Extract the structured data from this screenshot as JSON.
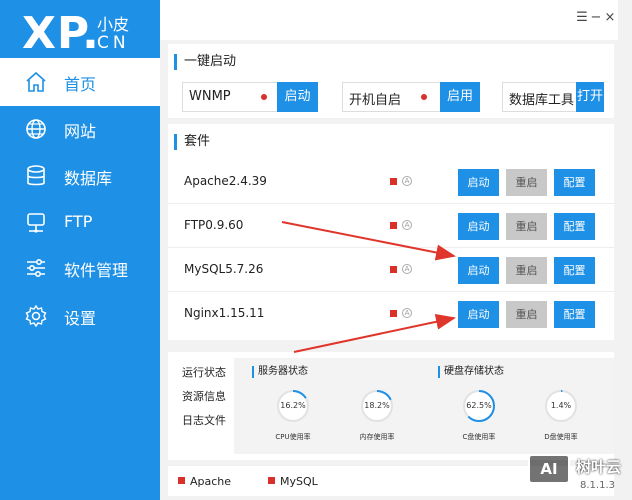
{
  "app": {
    "logo_main": "XP.",
    "logo_sub": "小皮",
    "logo_cn": "CN",
    "version": "8.1.1.3",
    "colors": {
      "accent": "#1e90e6",
      "status_red": "#d9302c",
      "arrow_red": "#e0352b"
    }
  },
  "sidebar": {
    "items": [
      {
        "label": "首页",
        "icon": "home-icon",
        "active": true
      },
      {
        "label": "网站",
        "icon": "globe-icon",
        "active": false
      },
      {
        "label": "数据库",
        "icon": "database-icon",
        "active": false
      },
      {
        "label": "FTP",
        "icon": "server-icon",
        "active": false
      },
      {
        "label": "软件管理",
        "icon": "sliders-icon",
        "active": false
      },
      {
        "label": "设置",
        "icon": "gear-icon",
        "active": false
      }
    ]
  },
  "window": {
    "menu_icon": "☰",
    "minimize_icon": "−",
    "close_icon": "×"
  },
  "quickstart": {
    "title": "一键启动",
    "items": [
      {
        "label": "WNMP",
        "button": "启动"
      },
      {
        "label": "开机自启",
        "button": "启用"
      },
      {
        "label": "数据库工具",
        "button": "打开"
      }
    ]
  },
  "suite": {
    "title": "套件",
    "rows": [
      {
        "name": "Apache2.4.39",
        "start": "启动",
        "restart": "重启",
        "config": "配置",
        "circle": "A"
      },
      {
        "name": "FTP0.9.60",
        "start": "启动",
        "restart": "重启",
        "config": "配置",
        "circle": "A"
      },
      {
        "name": "MySQL5.7.26",
        "start": "启动",
        "restart": "重启",
        "config": "配置",
        "circle": "A"
      },
      {
        "name": "Nginx1.15.11",
        "start": "启动",
        "restart": "重启",
        "config": "配置",
        "circle": "A"
      }
    ]
  },
  "bottom_tabs": [
    "运行状态",
    "资源信息",
    "日志文件"
  ],
  "server_status": {
    "title": "服务器状态",
    "gauges": [
      {
        "value": "16.2%",
        "percent": 16.2,
        "label": "CPU使用率"
      },
      {
        "value": "18.2%",
        "percent": 18.2,
        "label": "内存使用率"
      }
    ]
  },
  "disk_status": {
    "title": "硬盘存储状态",
    "gauges": [
      {
        "value": "62.5%",
        "percent": 62.5,
        "label": "C盘使用率"
      },
      {
        "value": "1.4%",
        "percent": 1.4,
        "label": "D盘使用率"
      }
    ]
  },
  "legend": [
    "Apache",
    "MySQL"
  ],
  "watermark": {
    "badge": "AI",
    "text": "树叶云"
  }
}
